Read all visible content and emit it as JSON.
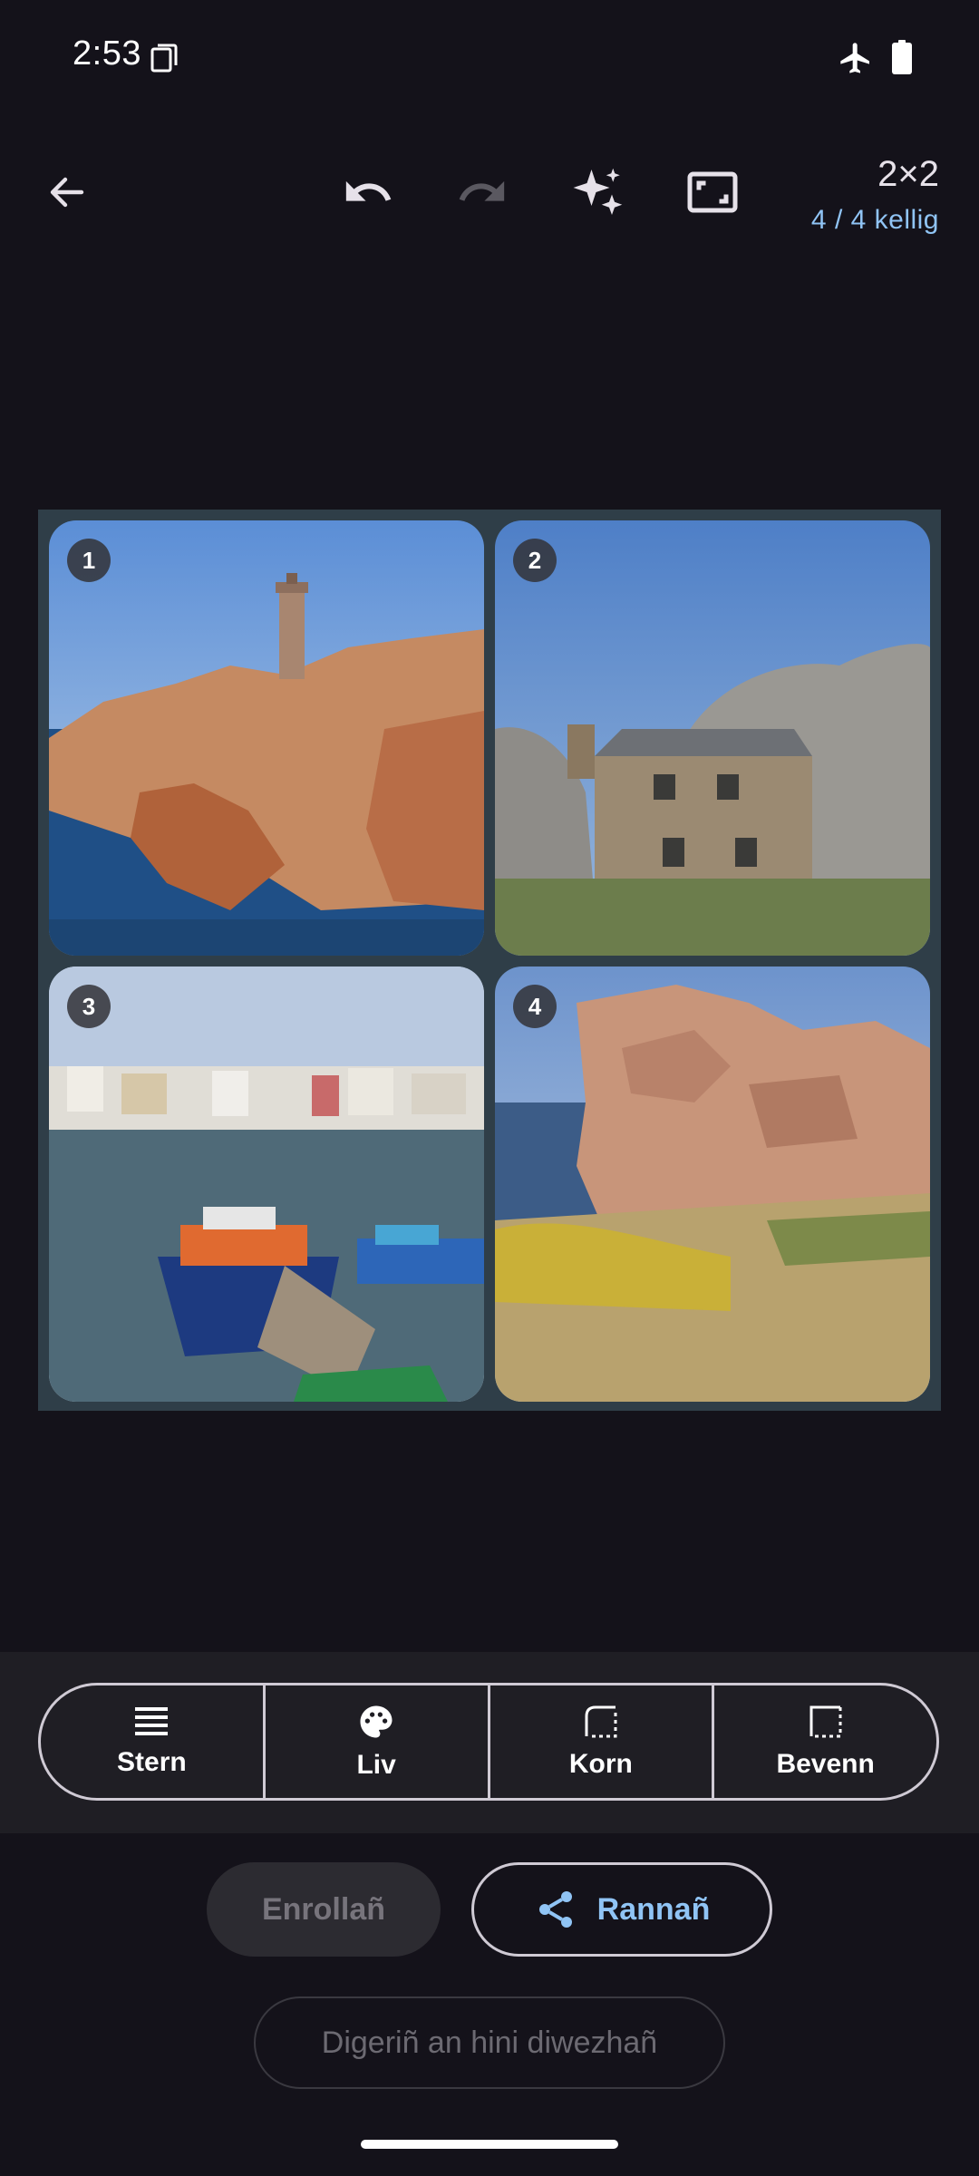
{
  "status_bar": {
    "time": "2:53",
    "icons": [
      "sim-card-icon",
      "airplane-mode-icon",
      "battery-icon"
    ]
  },
  "toolbar": {
    "icons": [
      "back-arrow-icon",
      "undo-icon",
      "redo-icon",
      "auto-enhance-icon",
      "aspect-frame-icon"
    ],
    "grid_label": "2×2",
    "cell_count": "4 / 4 kellig"
  },
  "collage": {
    "cells": [
      {
        "number": "1",
        "scene": "pink-granite-lighthouse"
      },
      {
        "number": "2",
        "scene": "stone-house-between-rocks"
      },
      {
        "number": "3",
        "scene": "harbor-with-boats"
      },
      {
        "number": "4",
        "scene": "granite-rocks-and-gorse"
      }
    ]
  },
  "tools": [
    {
      "label": "Stern",
      "icon": "layout-lines-icon"
    },
    {
      "label": "Liv",
      "icon": "palette-icon"
    },
    {
      "label": "Korn",
      "icon": "corner-radius-icon"
    },
    {
      "label": "Bevenn",
      "icon": "border-frame-icon"
    }
  ],
  "actions": {
    "save_label": "Enrollañ",
    "share_label": "Rannañ",
    "restore_label": "Digeriñ an hini diwezhañ"
  },
  "colors": {
    "background": "#14121a",
    "accent": "#90c4f5",
    "collage_background": "#2f3e48"
  }
}
